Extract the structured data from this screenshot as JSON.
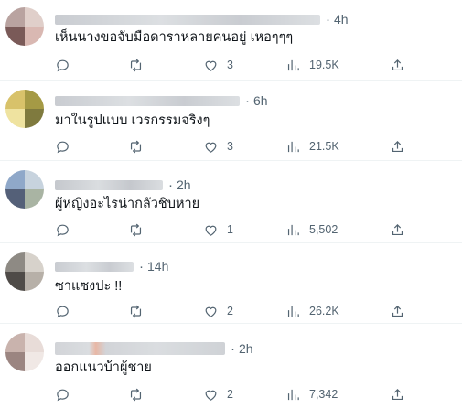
{
  "tweets": [
    {
      "time": "4h",
      "text": "เห็นนางขอจับมือดาราหลายคนอยู่ เหอๆๆๆ",
      "reply_icon": "reply-icon",
      "retweet_icon": "retweet-icon",
      "likes": "3",
      "views": "19.5K",
      "avatar_colors": [
        "#b9a3a0",
        "#e0cfca",
        "#7a5a58",
        "#d9b8b2"
      ],
      "name_blur_colors": [
        "#c9ccd1",
        "#dcdfe2"
      ]
    },
    {
      "time": "6h",
      "text": "มาในรูปแบบ เวรกรรมจริงๆ",
      "likes": "3",
      "views": "21.5K",
      "avatar_colors": [
        "#d8c26a",
        "#a59a45",
        "#efe3a0",
        "#7f7a3e"
      ],
      "name_blur_colors": [
        "#c9ccd1",
        "#dcdfe2"
      ]
    },
    {
      "time": "2h",
      "text": "ผู้หญิงอะไรน่ากลัวชิบหาย",
      "likes": "1",
      "views": "5,502",
      "avatar_colors": [
        "#8fa8c9",
        "#c7d3de",
        "#546078",
        "#a9b4a3"
      ],
      "name_blur_colors": [
        "#c5c8cd",
        "#dadde0"
      ]
    },
    {
      "time": "14h",
      "text": "ซาแซงปะ !!",
      "likes": "2",
      "views": "26.2K",
      "avatar_colors": [
        "#8e8a84",
        "#d7d2cb",
        "#4f4b48",
        "#b7b0a8"
      ],
      "name_blur_colors": [
        "#c9ccd1",
        "#dcdfe2"
      ]
    },
    {
      "time": "2h",
      "text": "ออกแนวบ้าผู้ชาย",
      "likes": "2",
      "views": "7,342",
      "avatar_colors": [
        "#c9b3ad",
        "#e8dcd8",
        "#9b8581",
        "#f0e8e5"
      ],
      "name_blur_colors": [
        "#e8b7a5",
        "#d2d4d8"
      ]
    }
  ]
}
